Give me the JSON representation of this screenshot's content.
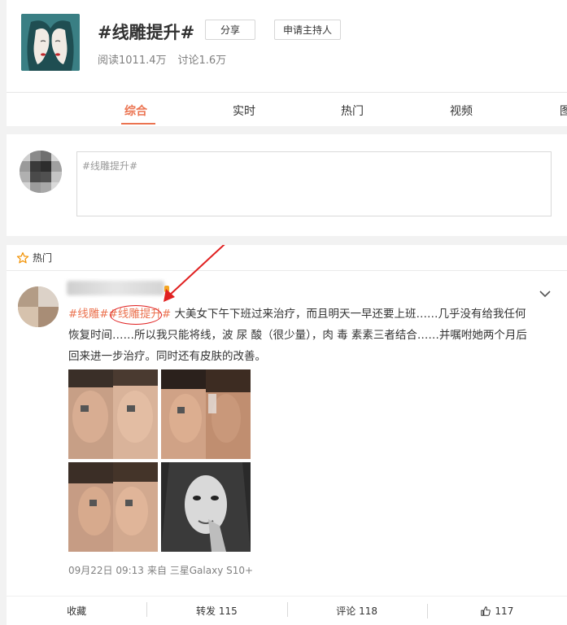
{
  "topic": {
    "title": "#线雕提升#",
    "share_label": "分享",
    "host_label": "申请主持人",
    "reads": "阅读1011.4万",
    "discussions": "讨论1.6万",
    "logo_icon": "twin-faces-logo"
  },
  "tabs": [
    {
      "label": "综合",
      "active": true
    },
    {
      "label": "实时",
      "active": false
    },
    {
      "label": "热门",
      "active": false
    },
    {
      "label": "视频",
      "active": false
    },
    {
      "label": "图",
      "active": false
    }
  ],
  "composer": {
    "placeholder": "#线雕提升#"
  },
  "feed": {
    "section_label": "热门",
    "section_icon": "star-outline-icon",
    "post": {
      "tag1": "#线雕#",
      "tag2": "#线雕提升#",
      "body_line1": " 大美女下午下班过来治疗，而且明天一早还要上班……几乎没有给我任何",
      "body_line2": "恢复时间……所以我只能将线，波 尿 酸（很少量），肉 毒 素素三者结合……并嘱咐她两个月后",
      "body_line3": "回来进一步治疗。同时还有皮肤的改善。",
      "date": "09月22日 09:13",
      "source": "来自 三星Galaxy S10+",
      "actions": {
        "favorite": "收藏",
        "repost": "转发 115",
        "comment": "评论 118",
        "like": "117"
      }
    }
  },
  "colors": {
    "accent": "#eb7350",
    "annotation_red": "#e02020",
    "logo_bg": "#3a7f84"
  }
}
